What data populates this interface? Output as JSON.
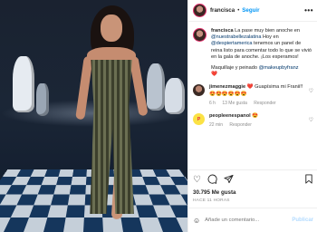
{
  "post": {
    "username": "francisca",
    "follow_label": "Seguir",
    "more_label": "•••",
    "caption_user": "francisca",
    "caption_parts": [
      "La pase muy bien anoche en ",
      "@nuestrabellezalatina",
      " Hoy en ",
      "@despiertamerica",
      " tenemos un panel de reina listo para comentar todo lo que se vivió en la gala de anoche. ¡Los esperamos!"
    ],
    "makeup_text": "Maquillaje y peinado ",
    "makeup_mention": "@makeupbyfranz",
    "caption_emoji": "❤️"
  },
  "comments": [
    {
      "user": "jimenezmaggie",
      "text": " ❤️ Guapísima mi Franii!! 😍😍😍😍😍😍",
      "time": "6 h",
      "likes": "13 Me gusta",
      "reply": "Responder"
    },
    {
      "user": "peopleenespanol",
      "avatar_text": "P",
      "text": " 😍",
      "time": "22 min",
      "reply": "Responder"
    }
  ],
  "actions": {
    "like_icon": "heart-icon",
    "comment_icon": "comment-icon",
    "share_icon": "share-icon",
    "save_icon": "bookmark-icon"
  },
  "likes_count": "30.795 Me gusta",
  "date": "HACE 11 HORAS",
  "add_comment": {
    "emoji": "☺",
    "placeholder": "Añade un comentario...",
    "publish_label": "Publicar"
  }
}
